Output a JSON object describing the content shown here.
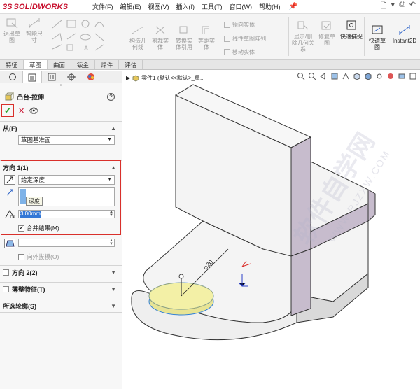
{
  "app": {
    "logo_prefix": "3S",
    "logo_name": "SOLIDWORKS"
  },
  "menu": [
    "文件(F)",
    "编辑(E)",
    "视图(V)",
    "插入(I)",
    "工具(T)",
    "窗口(W)",
    "帮助(H)"
  ],
  "toolbar": {
    "exit_sketch": "退出草图",
    "smart_dimension": "智能尺寸",
    "construct_geometry": "构造几何线",
    "cut_entities": "剪裁实体",
    "convert_entities": "转换实体引用",
    "equal_distance": "等距实体",
    "mirror_entities": "镜向实体",
    "linear_pattern": "线性草图阵列",
    "move_entities": "移动实体",
    "display_delete": "显示/删除几何关系",
    "repair_sketch": "修复草图",
    "quick_snap": "快速捕捉",
    "rapid_sketch": "快速草图",
    "instant2d": "Instant2D"
  },
  "tabs": [
    "特征",
    "草图",
    "曲面",
    "钣金",
    "焊件",
    "评估"
  ],
  "active_tab": 1,
  "panel": {
    "feature_title": "凸台-拉伸",
    "help": "?",
    "from_label": "从(F)",
    "from_value": "草图基准面",
    "direction1_label": "方向 1(1)",
    "end_condition": "给定深度",
    "tooltip": "深度",
    "depth_value": "3.00mm",
    "merge_result": "合并结果(M)",
    "draft_outward": "向外拔模(O)",
    "direction2_label": "方向 2(2)",
    "thin_feature": "薄壁特征(T)",
    "selected_contours": "所选轮廓(S)"
  },
  "viewport": {
    "tree_label": "零件1  (默认<<默认>_显...",
    "dimension": "⌀20",
    "watermark": "软件自学网",
    "watermark_url": "WWW.RJZXW.COM"
  },
  "colors": {
    "accent_red": "#d9302b",
    "face_light": "#f3f3f3",
    "face_side": "#c7bccd",
    "disk": "#f3f0a6"
  }
}
